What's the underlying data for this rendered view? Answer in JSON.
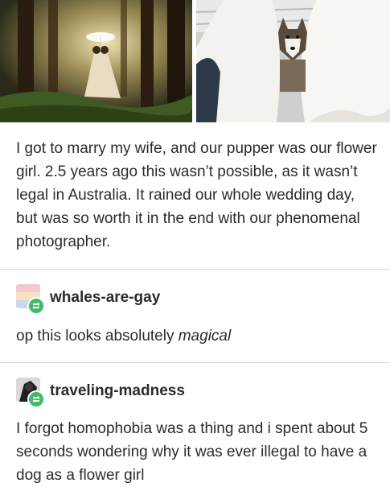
{
  "post": {
    "images": [
      {
        "icon": "wedding-rain-forest-photo"
      },
      {
        "icon": "husky-between-dresses-photo"
      }
    ],
    "text": "I got to marry my wife, and our pupper was our flower girl. 2.5 years ago this wasn’t possible, as it wasn’t legal in Australia. It rained our whole wedding day, but was so worth it in the end with our phenomenal photographer."
  },
  "replies": [
    {
      "username": "whales-are-gay",
      "text_prefix": "op this looks absolutely ",
      "text_emphasis": "magical"
    },
    {
      "username": "traveling-madness",
      "text": "I forgot homophobia was a thing and i spent about 5 seconds wondering why it was ever illegal to have a dog as a flower girl"
    }
  ],
  "colors": {
    "reblog_badge": "#43b86a",
    "divider": "#d8d8d8",
    "text": "#2b2b2b"
  }
}
